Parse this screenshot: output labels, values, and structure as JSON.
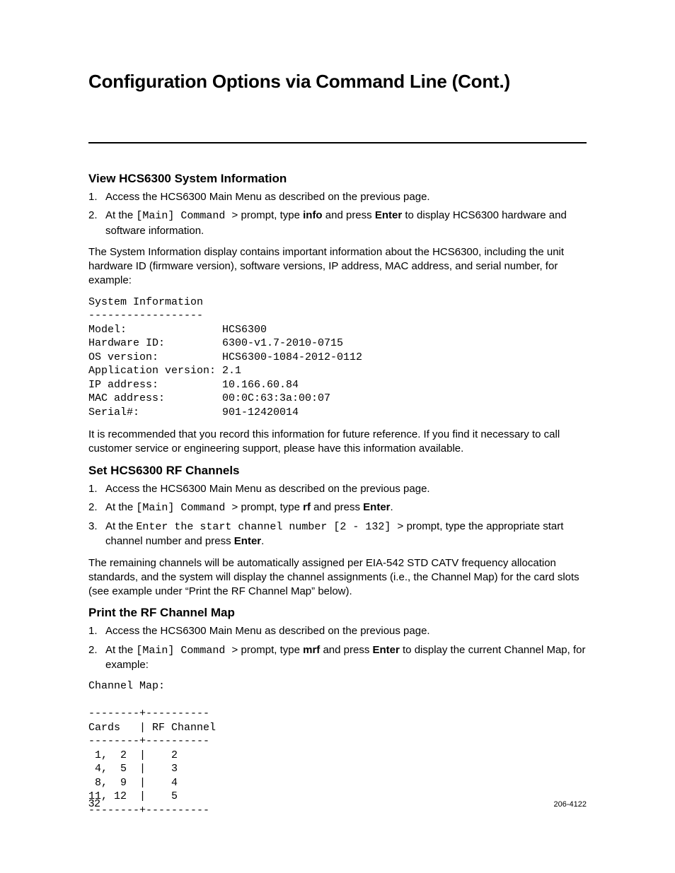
{
  "title": "Configuration Options via Command Line (Cont.)",
  "section1": {
    "heading": "View HCS6300 System Information",
    "step1": "Access the HCS6300 Main Menu as described on the previous page.",
    "step2_pre": "At the ",
    "step2_prompt": "[Main] Command >",
    "step2_mid": " prompt, type ",
    "step2_cmd": "info",
    "step2_mid2": " and press ",
    "step2_enter": "Enter",
    "step2_post": " to display HCS6300 hardware and software information.",
    "para1": "The System Information display contains important information about the HCS6300, including the unit hardware ID (firmware version), software versions, IP address, MAC address, and serial number, for example:",
    "sysinfo": "System Information\n------------------\nModel:               HCS6300\nHardware ID:         6300-v1.7-2010-0715\nOS version:          HCS6300-1084-2012-0112\nApplication version: 2.1\nIP address:          10.166.60.84\nMAC address:         00:0C:63:3a:00:07\nSerial#:             901-12420014",
    "para2": "It is recommended that you record this information for future reference. If you find it necessary to call customer service or engineering support, please have this information available."
  },
  "section2": {
    "heading": "Set HCS6300 RF Channels",
    "step1": "Access the HCS6300 Main Menu as described on the previous page.",
    "step2_pre": "At the ",
    "step2_prompt": "[Main] Command >",
    "step2_mid": " prompt, type ",
    "step2_cmd": "rf",
    "step2_mid2": " and press ",
    "step2_enter": "Enter",
    "step2_post": ".",
    "step3_pre": "At the ",
    "step3_prompt": "Enter the start channel number [2 - 132] >",
    "step3_mid": " prompt, type the appropriate start channel number and press ",
    "step3_enter": "Enter",
    "step3_post": ".",
    "para1": "The remaining channels will be automatically assigned per EIA-542 STD CATV frequency allocation standards, and the system will display the channel assignments (i.e., the Channel Map) for the card slots (see example under “Print the RF Channel Map” below)."
  },
  "section3": {
    "heading": "Print the RF Channel Map",
    "step1": "Access the HCS6300 Main Menu as described on the previous page.",
    "step2_pre": "At the ",
    "step2_prompt": "[Main] Command >",
    "step2_mid": " prompt, type ",
    "step2_cmd": "mrf",
    "step2_mid2": " and press ",
    "step2_enter": "Enter",
    "step2_post": " to display the current Channel Map, for example:",
    "chmap": "Channel Map:\n\n--------+----------\nCards   | RF Channel\n--------+----------\n 1,  2  |    2\n 4,  5  |    3\n 8,  9  |    4\n11, 12  |    5\n--------+----------"
  },
  "footer": {
    "page": "32",
    "doc": "206-4122"
  }
}
